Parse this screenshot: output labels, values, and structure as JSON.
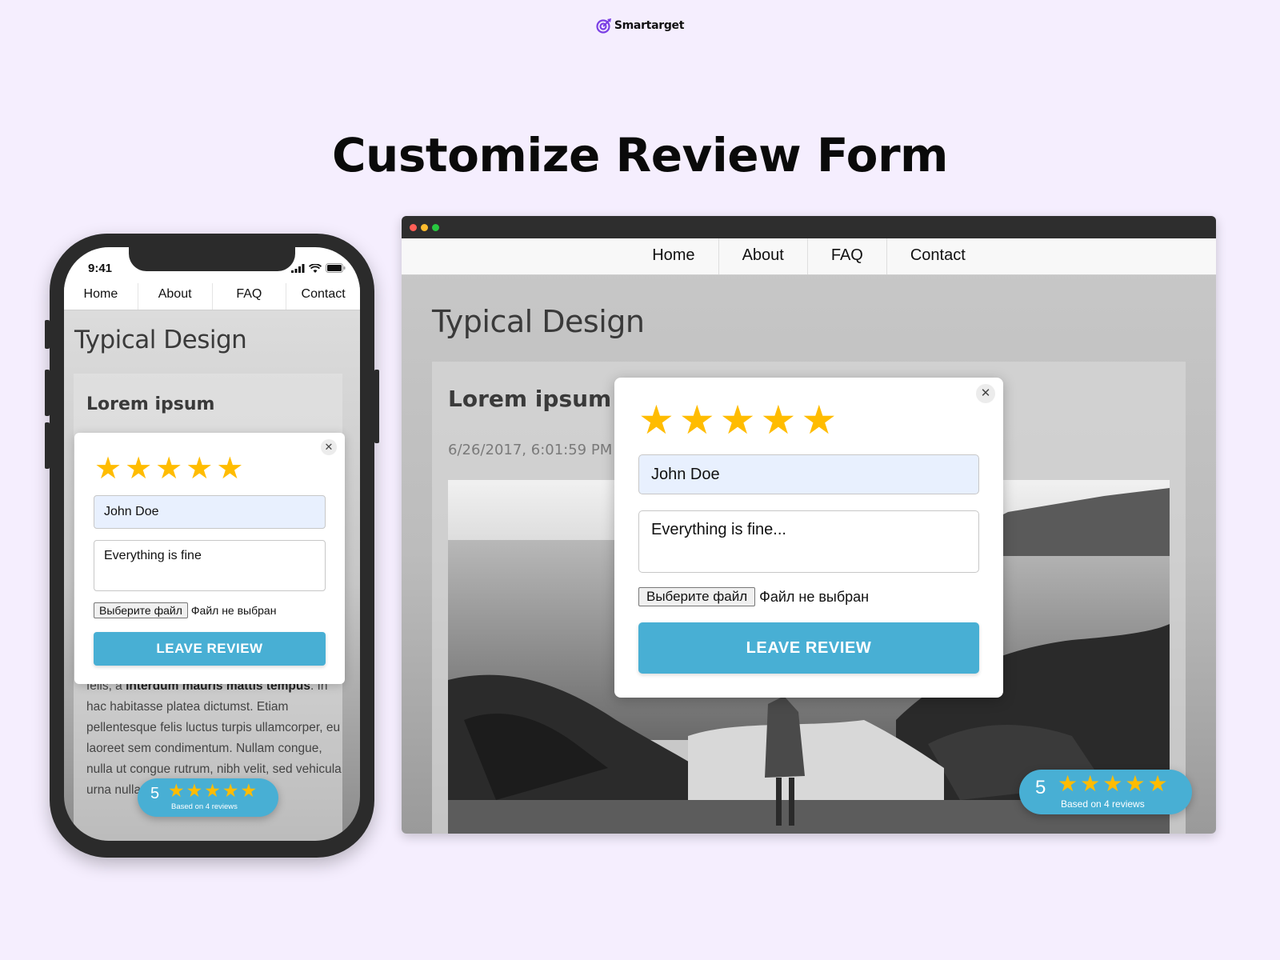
{
  "brand": {
    "name": "Smartarget",
    "accent": "#7b3fe4"
  },
  "headline": "Customize Review Form",
  "colors": {
    "background": "#f5eefe",
    "star": "#ffbc00",
    "button": "#48afd4",
    "name_field": "#e8f0fe"
  },
  "mobile": {
    "status_time": "9:41",
    "nav": [
      "Home",
      "About",
      "FAQ",
      "Contact"
    ],
    "page_title": "Typical Design",
    "card_title": "Lorem ipsum",
    "body_start": "felis, a ",
    "body_bold": "interdum mauris mattis tempus",
    "body_rest": ". In hac habitasse platea dictumst. Etiam pellentesque felis luctus turpis ullamcorper, eu laoreet sem condimentum. Nullam congue, nulla ut congue rutrum, nibh velit, sed vehicula urna nulla vitae",
    "form": {
      "rating": 5,
      "name_value": "John Doe",
      "message_value": "Everything is fine",
      "file_button": "Выберите файл",
      "file_status": "Файл не выбран",
      "submit": "LEAVE REVIEW"
    },
    "badge": {
      "score": "5",
      "subtitle": "Based on 4 reviews"
    }
  },
  "desktop": {
    "nav": [
      "Home",
      "About",
      "FAQ",
      "Contact"
    ],
    "page_title": "Typical Design",
    "card_title": "Lorem ipsum",
    "date": "6/26/2017, 6:01:59 PM",
    "form": {
      "rating": 5,
      "name_value": "John Doe",
      "message_value": "Everything is fine...",
      "file_button": "Выберите файл",
      "file_status": "Файл не выбран",
      "submit": "LEAVE REVIEW"
    },
    "badge": {
      "score": "5",
      "subtitle": "Based on 4 reviews"
    }
  }
}
